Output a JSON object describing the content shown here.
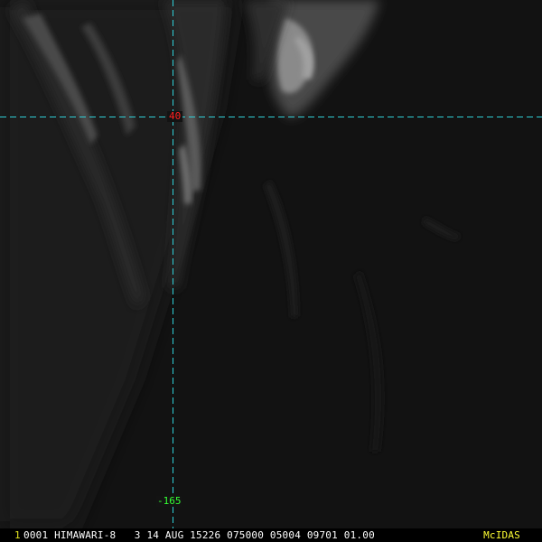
{
  "image": {
    "sensor_name": "HIMAWARI-8",
    "background_color": "#131313",
    "gridline_color": "#2fd0d8"
  },
  "grid": {
    "lat_label": "40",
    "lat_label_color": "#ff2020",
    "lon_label": "-165",
    "lon_label_color": "#33ff33"
  },
  "status_bar": {
    "frame_number": "1",
    "frame_number_color": "#e6e620",
    "text": "0001 HIMAWARI-8   3 14 AUG 15226 075000 05004 09701 01.00",
    "text_color": "#ffffff",
    "brand": "McIDAS",
    "brand_color": "#ffff33"
  }
}
